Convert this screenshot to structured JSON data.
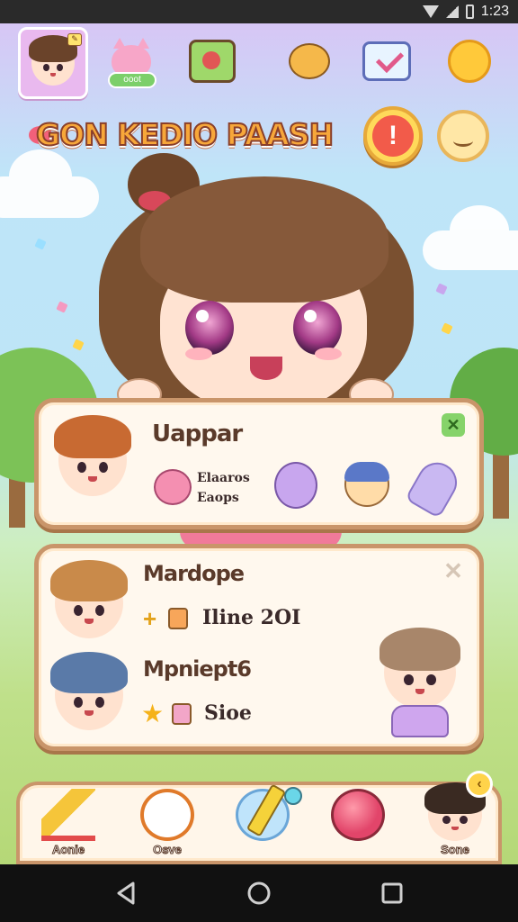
{
  "status_bar": {
    "time": "1:23"
  },
  "top_row": {
    "cat_pill_label": "ooot"
  },
  "title": {
    "text": "GON KEDIO PAASH"
  },
  "panel_1": {
    "title": "Uappar",
    "desc_line_1": "Elaaros",
    "desc_line_2": "Eaops"
  },
  "panel_2": {
    "row_1": {
      "name": "Mardope",
      "stat": "Iline 2OI"
    },
    "row_2": {
      "name": "Mpniept6",
      "stat": "Sioe"
    }
  },
  "dock": {
    "items": [
      {
        "label": "Aonie"
      },
      {
        "label": "Osve"
      },
      {
        "label": ""
      },
      {
        "label": ""
      },
      {
        "label": "Sone"
      }
    ]
  },
  "colors": {
    "panel_border": "#c9956a",
    "title_fill": "#f7a73a",
    "alert_red": "#f25b4a",
    "accent_green": "#86d36a"
  }
}
